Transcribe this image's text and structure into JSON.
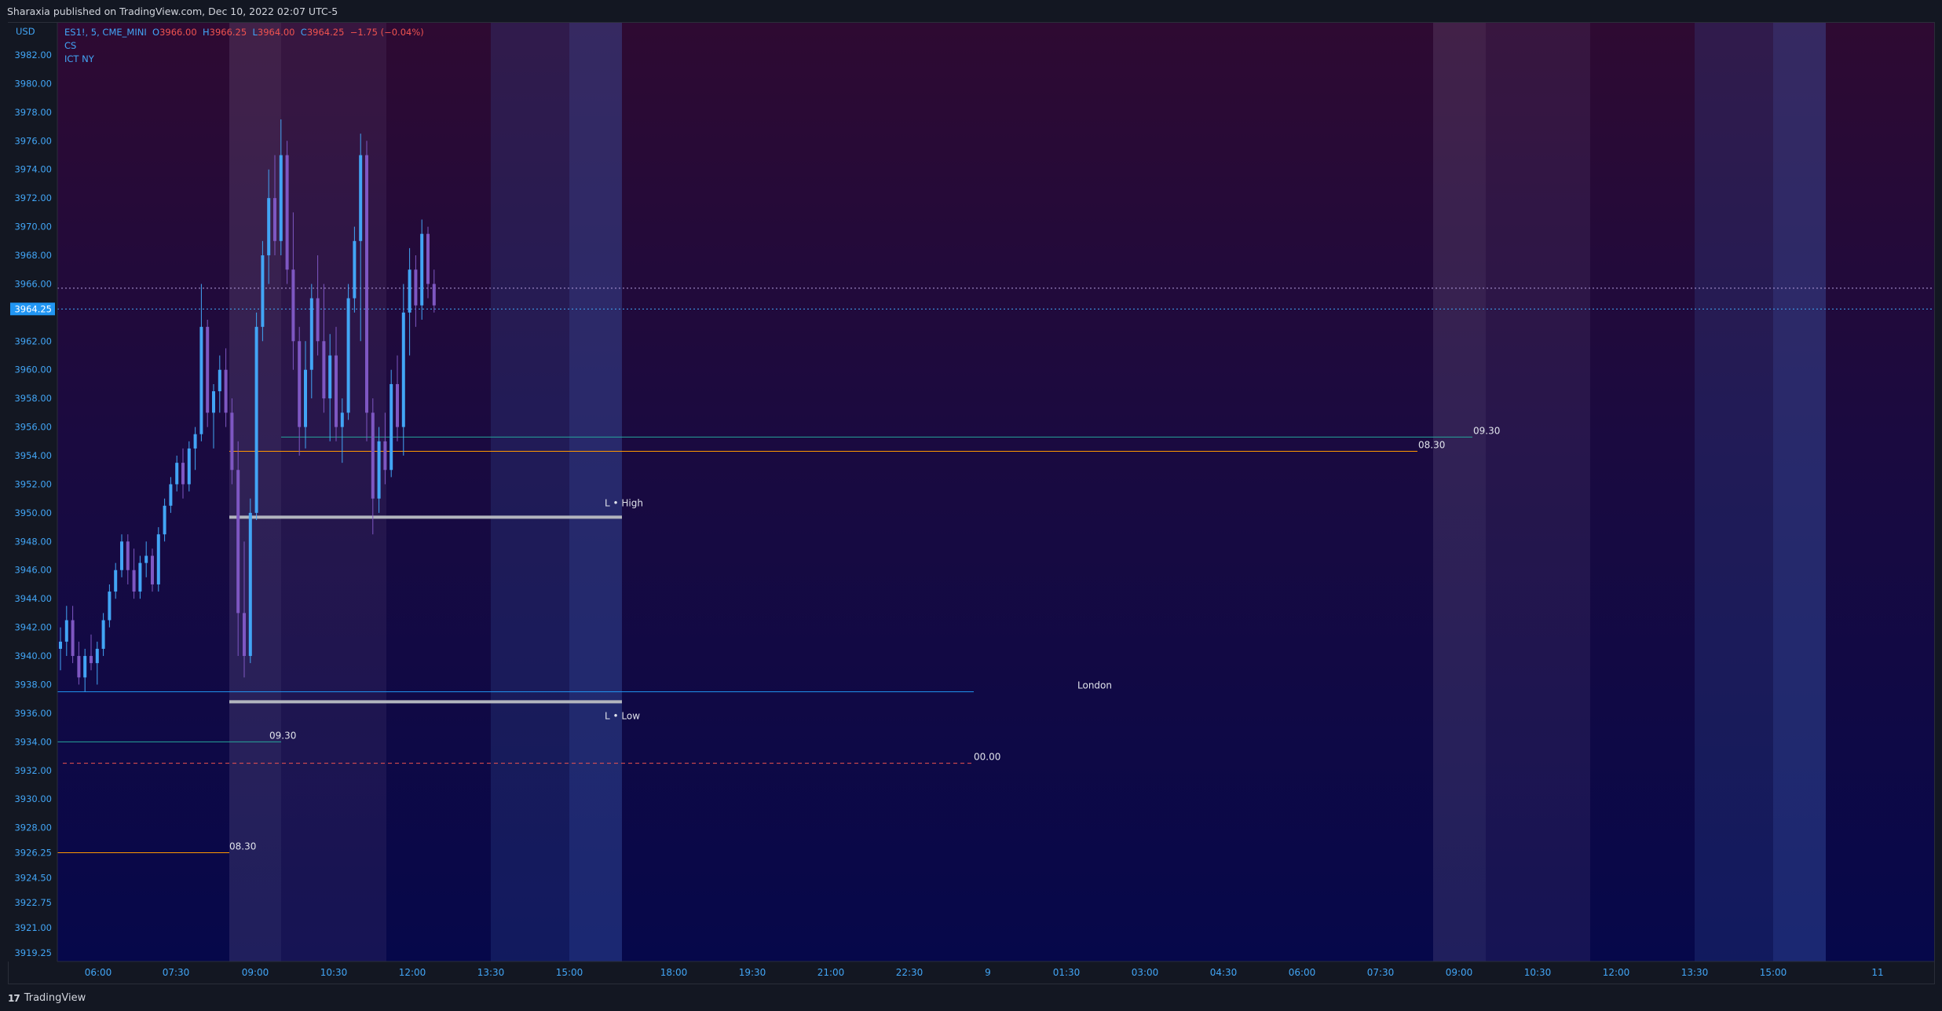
{
  "header": {
    "published": "Sharaxia published on TradingView.com, Dec 10, 2022 02:07 UTC-5"
  },
  "legend": {
    "symbol": "ES1!, 5, CME_MINI",
    "o_label": "O",
    "o_value": "3966.00",
    "h_label": "H",
    "h_value": "3966.25",
    "l_label": "L",
    "l_value": "3964.00",
    "c_label": "C",
    "c_value": "3964.25",
    "change": "−1.75 (−0.04%)",
    "indicator1": "CS",
    "indicator2": "ICT NY"
  },
  "currency": "USD",
  "footer": {
    "brand": "TradingView",
    "logo_text": "17"
  },
  "colors": {
    "accent": "#42a5f5",
    "down": "#ef5350",
    "bg_top": "#2a0a2e",
    "bg_bottom": "#08083e",
    "candle_up": "#42a5f5",
    "candle_down": "#7e57c2"
  },
  "chart_data": {
    "type": "candlestick",
    "symbol": "ES1!",
    "interval": "5",
    "y_ticks": [
      "3982.00",
      "3980.00",
      "3978.00",
      "3976.00",
      "3974.00",
      "3972.00",
      "3970.00",
      "3968.00",
      "3966.00",
      "3964.25",
      "3962.00",
      "3960.00",
      "3958.00",
      "3956.00",
      "3954.00",
      "3952.00",
      "3950.00",
      "3948.00",
      "3946.00",
      "3944.00",
      "3942.00",
      "3940.00",
      "3938.00",
      "3936.00",
      "3934.00",
      "3932.00",
      "3930.00",
      "3928.00",
      "3926.25",
      "3924.50",
      "3922.75",
      "3921.00",
      "3919.25"
    ],
    "current_price": "3964.25",
    "ylim": [
      3919.25,
      3983.5
    ],
    "x_ticks": [
      "06:00",
      "07:30",
      "09:00",
      "10:30",
      "12:00",
      "13:30",
      "15:00",
      "18:00",
      "19:30",
      "21:00",
      "22:30",
      "9",
      "01:30",
      "03:00",
      "04:30",
      "06:00",
      "07:30",
      "09:00",
      "10:30",
      "12:00",
      "13:30",
      "15:00",
      "11"
    ],
    "sessions": [
      {
        "kind": "light",
        "start": "08:30",
        "end": "09:30"
      },
      {
        "kind": "light",
        "start": "09:30",
        "end": "11:30"
      },
      {
        "kind": "blue",
        "start": "13:30",
        "end": "15:00"
      },
      {
        "kind": "blue",
        "start": "15:00",
        "end": "16:00"
      },
      {
        "kind": "light",
        "start": "08:30",
        "end": "09:30"
      },
      {
        "kind": "light",
        "start": "09:30",
        "end": "11:30"
      },
      {
        "kind": "blue",
        "start": "13:30",
        "end": "15:00"
      },
      {
        "kind": "blue",
        "start": "15:00",
        "end": "16:00"
      }
    ],
    "levels": [
      {
        "name": "08.30",
        "price": 3926.25,
        "color": "#ff9800",
        "label": "08.30"
      },
      {
        "name": "09.30",
        "price": 3934.0,
        "color": "#26a69a",
        "label": "09.30"
      },
      {
        "name": "00.00",
        "price": 3932.5,
        "color": "#ef5350",
        "label": "00.00",
        "dashed": true
      },
      {
        "name": "London",
        "price": 3937.5,
        "color": "#2196f3",
        "label": "London"
      },
      {
        "name": "L - Low",
        "price": 3936.8,
        "color": "#b2b5be",
        "label": "L • Low"
      },
      {
        "name": "L - High",
        "price": 3949.7,
        "color": "#b2b5be",
        "label": "L • High"
      },
      {
        "name": "08.30 day2",
        "price": 3954.3,
        "color": "#ff9800",
        "label": "08.30"
      },
      {
        "name": "09.30 day2",
        "price": 3955.3,
        "color": "#26a69a",
        "label": "09.30"
      },
      {
        "name": "open dotted",
        "price": 3965.7,
        "color": "#b39ddb",
        "label": "",
        "dotted": true
      },
      {
        "name": "last dotted",
        "price": 3964.25,
        "color": "#42a5f5",
        "label": "",
        "dotted": true
      }
    ],
    "candles": [
      [
        3940.5,
        3942.0,
        3939.0,
        3941.0
      ],
      [
        3941.0,
        3943.5,
        3940.0,
        3942.5
      ],
      [
        3942.5,
        3943.5,
        3939.5,
        3940.0
      ],
      [
        3940.0,
        3941.0,
        3938.0,
        3938.5
      ],
      [
        3938.5,
        3940.5,
        3937.5,
        3940.0
      ],
      [
        3940.0,
        3941.5,
        3939.0,
        3939.5
      ],
      [
        3939.5,
        3941.0,
        3938.0,
        3940.5
      ],
      [
        3940.5,
        3943.0,
        3940.0,
        3942.5
      ],
      [
        3942.5,
        3945.0,
        3942.0,
        3944.5
      ],
      [
        3944.5,
        3946.5,
        3944.0,
        3946.0
      ],
      [
        3946.0,
        3948.5,
        3945.5,
        3948.0
      ],
      [
        3948.0,
        3948.5,
        3945.0,
        3946.0
      ],
      [
        3946.0,
        3947.5,
        3944.0,
        3944.5
      ],
      [
        3944.5,
        3947.0,
        3944.0,
        3946.5
      ],
      [
        3946.5,
        3948.0,
        3945.5,
        3947.0
      ],
      [
        3947.0,
        3947.5,
        3944.5,
        3945.0
      ],
      [
        3945.0,
        3949.0,
        3944.5,
        3948.5
      ],
      [
        3948.5,
        3951.0,
        3948.0,
        3950.5
      ],
      [
        3950.5,
        3952.5,
        3950.0,
        3952.0
      ],
      [
        3952.0,
        3954.0,
        3951.5,
        3953.5
      ],
      [
        3953.5,
        3954.5,
        3951.0,
        3952.0
      ],
      [
        3952.0,
        3955.0,
        3951.5,
        3954.5
      ],
      [
        3954.5,
        3956.0,
        3953.0,
        3955.5
      ],
      [
        3955.5,
        3966.0,
        3955.0,
        3963.0
      ],
      [
        3963.0,
        3963.5,
        3956.0,
        3957.0
      ],
      [
        3957.0,
        3959.0,
        3954.5,
        3958.5
      ],
      [
        3958.5,
        3961.0,
        3957.0,
        3960.0
      ],
      [
        3960.0,
        3961.5,
        3956.0,
        3957.0
      ],
      [
        3957.0,
        3958.0,
        3952.0,
        3953.0
      ],
      [
        3953.0,
        3955.0,
        3940.0,
        3943.0
      ],
      [
        3943.0,
        3948.0,
        3938.5,
        3940.0
      ],
      [
        3940.0,
        3951.0,
        3939.5,
        3950.0
      ],
      [
        3950.0,
        3964.0,
        3949.5,
        3963.0
      ],
      [
        3963.0,
        3969.0,
        3962.0,
        3968.0
      ],
      [
        3968.0,
        3974.0,
        3966.0,
        3972.0
      ],
      [
        3972.0,
        3975.0,
        3968.0,
        3969.0
      ],
      [
        3969.0,
        3977.5,
        3968.0,
        3975.0
      ],
      [
        3975.0,
        3976.0,
        3966.0,
        3967.0
      ],
      [
        3967.0,
        3971.0,
        3960.0,
        3962.0
      ],
      [
        3962.0,
        3963.0,
        3954.0,
        3956.0
      ],
      [
        3956.0,
        3962.0,
        3954.5,
        3960.0
      ],
      [
        3960.0,
        3966.0,
        3958.0,
        3965.0
      ],
      [
        3965.0,
        3968.0,
        3961.0,
        3962.0
      ],
      [
        3962.0,
        3966.0,
        3957.0,
        3958.0
      ],
      [
        3958.0,
        3962.5,
        3955.0,
        3961.0
      ],
      [
        3961.0,
        3963.0,
        3955.0,
        3956.0
      ],
      [
        3956.0,
        3958.0,
        3953.5,
        3957.0
      ],
      [
        3957.0,
        3966.0,
        3956.5,
        3965.0
      ],
      [
        3965.0,
        3970.0,
        3964.0,
        3969.0
      ],
      [
        3969.0,
        3976.5,
        3962.0,
        3975.0
      ],
      [
        3975.0,
        3976.0,
        3955.0,
        3957.0
      ],
      [
        3957.0,
        3958.0,
        3948.5,
        3951.0
      ],
      [
        3951.0,
        3956.0,
        3950.0,
        3955.0
      ],
      [
        3955.0,
        3957.0,
        3952.0,
        3953.0
      ],
      [
        3953.0,
        3960.0,
        3952.5,
        3959.0
      ],
      [
        3959.0,
        3961.0,
        3955.0,
        3956.0
      ],
      [
        3956.0,
        3966.0,
        3954.0,
        3964.0
      ],
      [
        3964.0,
        3968.5,
        3961.0,
        3967.0
      ],
      [
        3967.0,
        3968.0,
        3963.0,
        3964.5
      ],
      [
        3964.5,
        3970.5,
        3963.5,
        3969.5
      ],
      [
        3969.5,
        3970.0,
        3965.0,
        3966.0
      ],
      [
        3966.0,
        3967.0,
        3964.0,
        3964.5
      ]
    ]
  }
}
